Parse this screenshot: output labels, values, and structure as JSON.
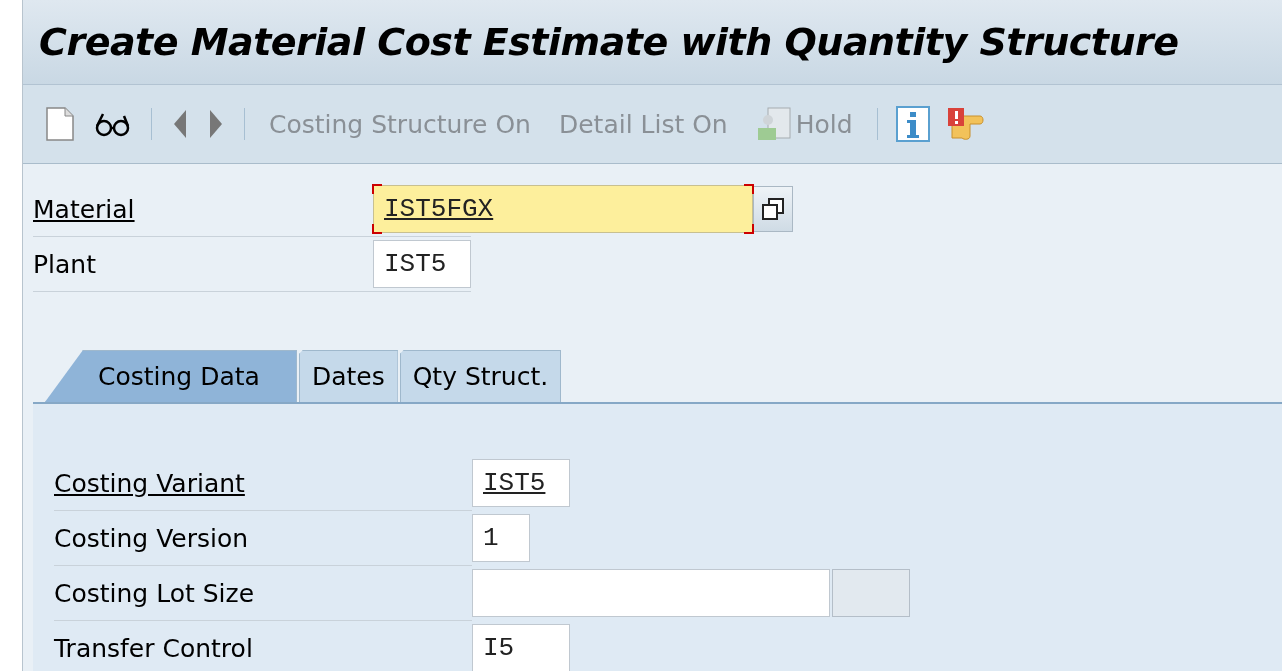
{
  "window": {
    "title": "Create Material Cost Estimate with Quantity Structure"
  },
  "toolbar": [
    {
      "kind": "new",
      "disabled": false
    },
    {
      "kind": "display",
      "disabled": false
    },
    {
      "kind": "separator"
    },
    {
      "kind": "previous",
      "disabled": false
    },
    {
      "kind": "next",
      "disabled": false
    },
    {
      "kind": "separator"
    },
    {
      "kind": "text",
      "label": "Costing Structure On",
      "disabled": true
    },
    {
      "kind": "text",
      "label": "Detail List On",
      "disabled": true
    },
    {
      "kind": "hold",
      "label": "Hold",
      "disabled": true
    },
    {
      "kind": "separator"
    },
    {
      "kind": "info",
      "disabled": false
    },
    {
      "kind": "message",
      "disabled": false
    }
  ],
  "header_fields": [
    {
      "label": "Material",
      "value": "IST5FGX",
      "kind": "material",
      "required": true,
      "focused": true
    },
    {
      "label": "Plant",
      "value": "IST5",
      "kind": "code",
      "required": false,
      "focused": false
    }
  ],
  "tabs": [
    {
      "label": "Costing Data",
      "selected": true
    },
    {
      "label": "Dates",
      "selected": false
    },
    {
      "label": "Qty Struct.",
      "selected": false
    }
  ],
  "costing_fields": [
    {
      "label": "Costing Variant",
      "value": "IST5",
      "kind": "code",
      "required": true
    },
    {
      "label": "Costing Version",
      "value": "1",
      "kind": "short",
      "required": false
    },
    {
      "label": "Costing Lot Size",
      "kind": "quantity",
      "required": false
    },
    {
      "label": "Transfer Control",
      "value": "I5",
      "kind": "code",
      "required": false
    }
  ]
}
